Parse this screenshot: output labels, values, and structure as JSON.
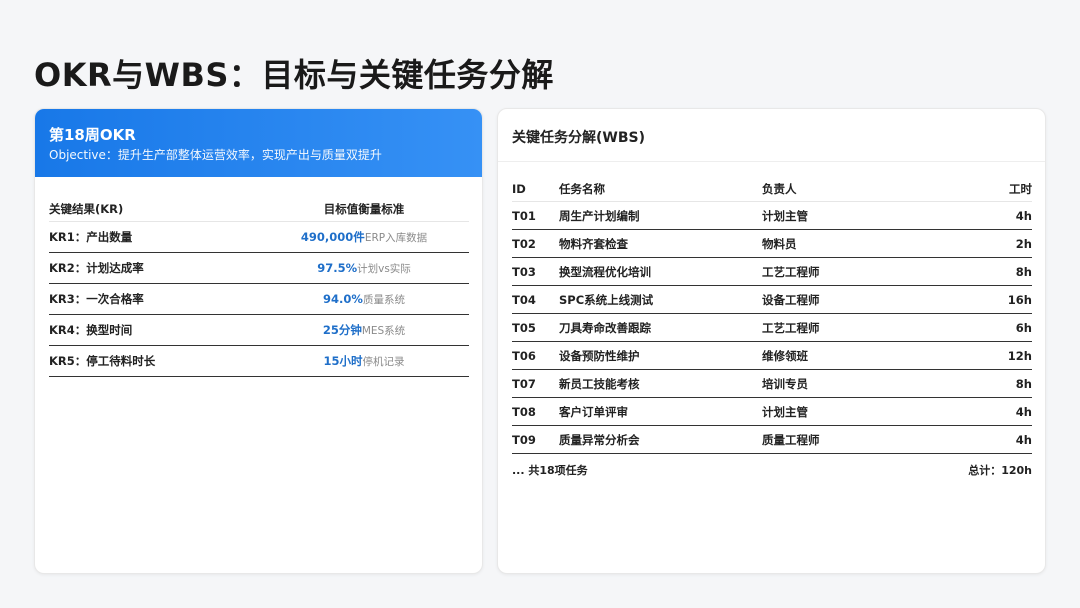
{
  "page": {
    "title": "OKR与WBS：目标与关键任务分解"
  },
  "okr": {
    "week_label": "第18周OKR",
    "objective": "Objective：提升生产部整体运营效率，实现产出与质量双提升",
    "headers": {
      "kr": "关键结果(KR)",
      "standard": "目标值衡量标准"
    },
    "rows": [
      {
        "kr": "KR1：产出数量",
        "target": "490,000件",
        "source": "ERP入库数据"
      },
      {
        "kr": "KR2：计划达成率",
        "target": "97.5%",
        "source": "计划vs实际"
      },
      {
        "kr": "KR3：一次合格率",
        "target": "94.0%",
        "source": "质量系统"
      },
      {
        "kr": "KR4：换型时间",
        "target": "25分钟",
        "source": "MES系统"
      },
      {
        "kr": "KR5：停工待料时长",
        "target": "15小时",
        "source": "停机记录"
      }
    ]
  },
  "wbs": {
    "title": "关键任务分解(WBS)",
    "headers": {
      "id": "ID",
      "name": "任务名称",
      "owner": "负责人",
      "hours": "工时"
    },
    "rows": [
      {
        "id": "T01",
        "name": "周生产计划编制",
        "owner": "计划主管",
        "hours": "4h"
      },
      {
        "id": "T02",
        "name": "物料齐套检查",
        "owner": "物料员",
        "hours": "2h"
      },
      {
        "id": "T03",
        "name": "换型流程优化培训",
        "owner": "工艺工程师",
        "hours": "8h"
      },
      {
        "id": "T04",
        "name": "SPC系统上线测试",
        "owner": "设备工程师",
        "hours": "16h"
      },
      {
        "id": "T05",
        "name": "刀具寿命改善跟踪",
        "owner": "工艺工程师",
        "hours": "6h"
      },
      {
        "id": "T06",
        "name": "设备预防性维护",
        "owner": "维修领班",
        "hours": "12h"
      },
      {
        "id": "T07",
        "name": "新员工技能考核",
        "owner": "培训专员",
        "hours": "8h"
      },
      {
        "id": "T08",
        "name": "客户订单评审",
        "owner": "计划主管",
        "hours": "4h"
      },
      {
        "id": "T09",
        "name": "质量异常分析会",
        "owner": "质量工程师",
        "hours": "4h"
      }
    ],
    "footer_left": "... 共18项任务",
    "footer_right": "总计：120h"
  },
  "colors": {
    "accent": "#1878e8",
    "target_text": "#1f6fc9",
    "source_text": "#8a8a8a"
  }
}
